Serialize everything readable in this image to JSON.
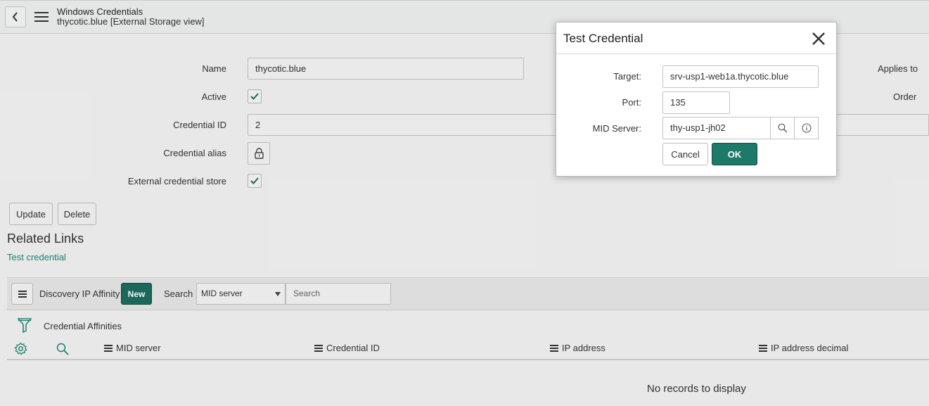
{
  "header": {
    "title": "Windows Credentials",
    "subtitle": "thycotic.blue [External Storage view]"
  },
  "form": {
    "name_label": "Name",
    "name_value": "thycotic.blue",
    "active_label": "Active",
    "credential_id_label": "Credential ID",
    "credential_id_value": "2",
    "credential_alias_label": "Credential alias",
    "external_store_label": "External credential store",
    "applies_to_label": "Applies to",
    "order_label": "Order"
  },
  "buttons": {
    "update": "Update",
    "delete": "Delete"
  },
  "related": {
    "title": "Related Links",
    "test_link": "Test credential"
  },
  "list": {
    "name": "Discovery IP Affinity",
    "new_label": "New",
    "search_label": "Search",
    "search_field": "MID server",
    "search_placeholder": "Search",
    "filter_label": "Credential Affinities",
    "columns": [
      "MID server",
      "Credential ID",
      "IP address",
      "IP address decimal"
    ],
    "empty_message": "No records to display"
  },
  "modal": {
    "title": "Test Credential",
    "target_label": "Target:",
    "target_value": "srv-usp1-web1a.thycotic.blue",
    "port_label": "Port:",
    "port_value": "135",
    "mid_label": "MID Server:",
    "mid_value": "thy-usp1-jh02",
    "cancel_label": "Cancel",
    "ok_label": "OK"
  },
  "colors": {
    "accent": "#1d6d5f",
    "link": "#1f8476"
  },
  "icons": [
    "back-arrow-icon",
    "hamburger-icon",
    "checkmark-icon",
    "lock-icon",
    "filter-funnel-icon",
    "gear-icon",
    "search-icon",
    "info-icon",
    "close-icon"
  ]
}
